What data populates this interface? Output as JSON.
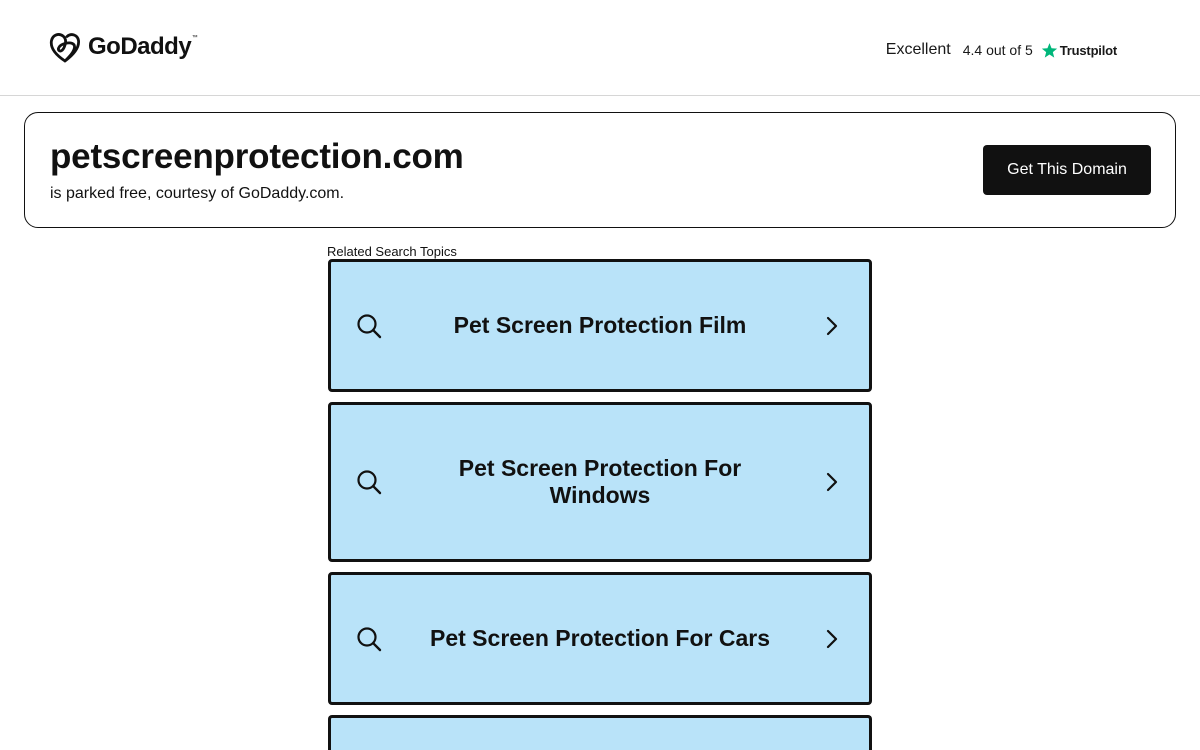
{
  "header": {
    "logo_text": "GoDaddy",
    "logo_tm": "™",
    "trust": {
      "rating_word": "Excellent",
      "score_text": "4.4 out of 5",
      "brand": "Trustpilot",
      "star_color": "#00b67a"
    }
  },
  "domain_card": {
    "domain": "petscreenprotection.com",
    "subtitle": "is parked free, courtesy of GoDaddy.com.",
    "cta_label": "Get This Domain"
  },
  "related": {
    "label": "Related Search Topics",
    "topics": [
      {
        "label": "Pet Screen Protection Film"
      },
      {
        "label": "Pet Screen Protection For Windows"
      },
      {
        "label": "Pet Screen Protection For Cars"
      },
      {
        "label": ""
      }
    ]
  },
  "colors": {
    "topic_background": "#b9e3f9",
    "border": "#111111",
    "cta_background": "#111111",
    "cta_text": "#ffffff"
  }
}
